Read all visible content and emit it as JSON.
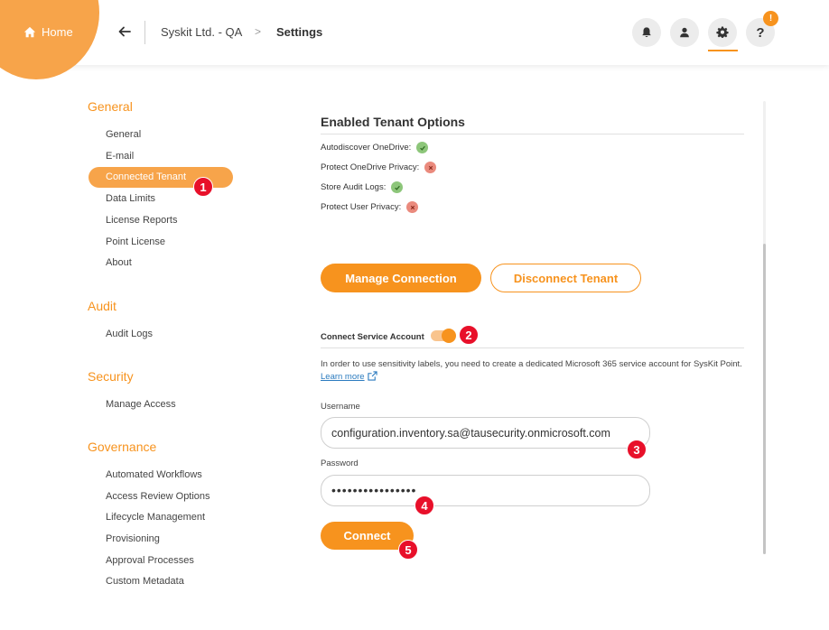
{
  "header": {
    "home_label": "Home",
    "breadcrumb_tenant": "Syskit Ltd. - QA",
    "breadcrumb_separator": ">",
    "breadcrumb_page": "Settings",
    "help_label": "?",
    "help_badge": "!"
  },
  "sidebar": {
    "sections": [
      {
        "title": "General",
        "items": [
          "General",
          "E-mail",
          "Connected Tenant",
          "Data Limits",
          "License Reports",
          "Point License",
          "About"
        ]
      },
      {
        "title": "Audit",
        "items": [
          "Audit Logs"
        ]
      },
      {
        "title": "Security",
        "items": [
          "Manage Access"
        ]
      },
      {
        "title": "Governance",
        "items": [
          "Automated Workflows",
          "Access Review Options",
          "Lifecycle Management",
          "Provisioning",
          "Approval Processes",
          "Custom Metadata"
        ]
      }
    ],
    "active_item": "Connected Tenant"
  },
  "tenant_options": {
    "title": "Enabled Tenant Options",
    "items": [
      {
        "label": "Autodiscover OneDrive:",
        "enabled": true
      },
      {
        "label": "Protect OneDrive Privacy:",
        "enabled": false
      },
      {
        "label": "Store Audit Logs:",
        "enabled": true
      },
      {
        "label": "Protect User Privacy:",
        "enabled": false
      }
    ]
  },
  "actions": {
    "manage_label": "Manage Connection",
    "disconnect_label": "Disconnect Tenant"
  },
  "service_account": {
    "label": "Connect Service Account",
    "toggle_on": true,
    "info_text": "In order to use sensitivity labels, you need to create a dedicated Microsoft 365 service account for SysKit Point.",
    "learn_more": "Learn more",
    "username_label": "Username",
    "username_value": "configuration.inventory.sa@tausecurity.onmicrosoft.com",
    "password_label": "Password",
    "password_value": "••••••••••••••••",
    "connect_label": "Connect"
  },
  "markers": [
    "1",
    "2",
    "3",
    "4",
    "5"
  ],
  "colors": {
    "accent": "#f7931e",
    "accent_light": "#f7a44a",
    "ok": "#8dc67a",
    "no": "#ea8a7d",
    "marker": "#e8102a"
  }
}
